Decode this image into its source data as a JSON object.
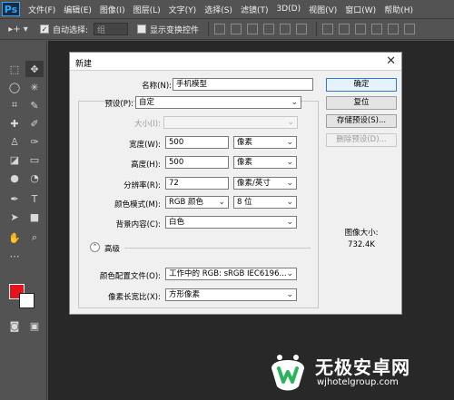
{
  "app": {
    "logo": "Ps"
  },
  "menu": [
    "文件(F)",
    "编辑(E)",
    "图像(I)",
    "图层(L)",
    "文字(Y)",
    "选择(S)",
    "滤镜(T)",
    "3D(D)",
    "视图(V)",
    "窗口(W)",
    "帮助(H)"
  ],
  "options_bar": {
    "tool_glyph": "▸+ ▾",
    "auto_select_label": "自动选择:",
    "auto_select_value": "组",
    "show_transform_label": "显示变换控件"
  },
  "colors": {
    "foreground": "#e8121a",
    "background": "#ffffff"
  },
  "dialog": {
    "title": "新建",
    "close_glyph": "✕",
    "name_label": "名称(N):",
    "name_value": "手机模型",
    "preset_label": "预设(P):",
    "preset_value": "自定",
    "size_label": "大小(I):",
    "size_value": "",
    "width_label": "宽度(W):",
    "width_value": "500",
    "width_unit": "像素",
    "height_label": "高度(H):",
    "height_value": "500",
    "height_unit": "像素",
    "resolution_label": "分辨率(R):",
    "resolution_value": "72",
    "resolution_unit": "像素/英寸",
    "color_mode_label": "颜色模式(M):",
    "color_mode_value": "RGB 颜色",
    "bit_depth_value": "8 位",
    "background_label": "背景内容(C):",
    "background_value": "白色",
    "advanced_label": "高级",
    "advanced_glyph": "⌃",
    "color_profile_label": "颜色配置文件(O):",
    "color_profile_value": "工作中的 RGB: sRGB IEC6196...",
    "pixel_aspect_label": "像素长宽比(X):",
    "pixel_aspect_value": "方形像素",
    "buttons": {
      "ok": "确定",
      "reset": "复位",
      "save_preset": "存储预设(S)...",
      "delete_preset": "删除预设(D)..."
    },
    "image_size_title": "图像大小:",
    "image_size_value": "732.4K"
  },
  "watermark": {
    "title": "无极安卓网",
    "url": "wjhotelgroup.com"
  }
}
